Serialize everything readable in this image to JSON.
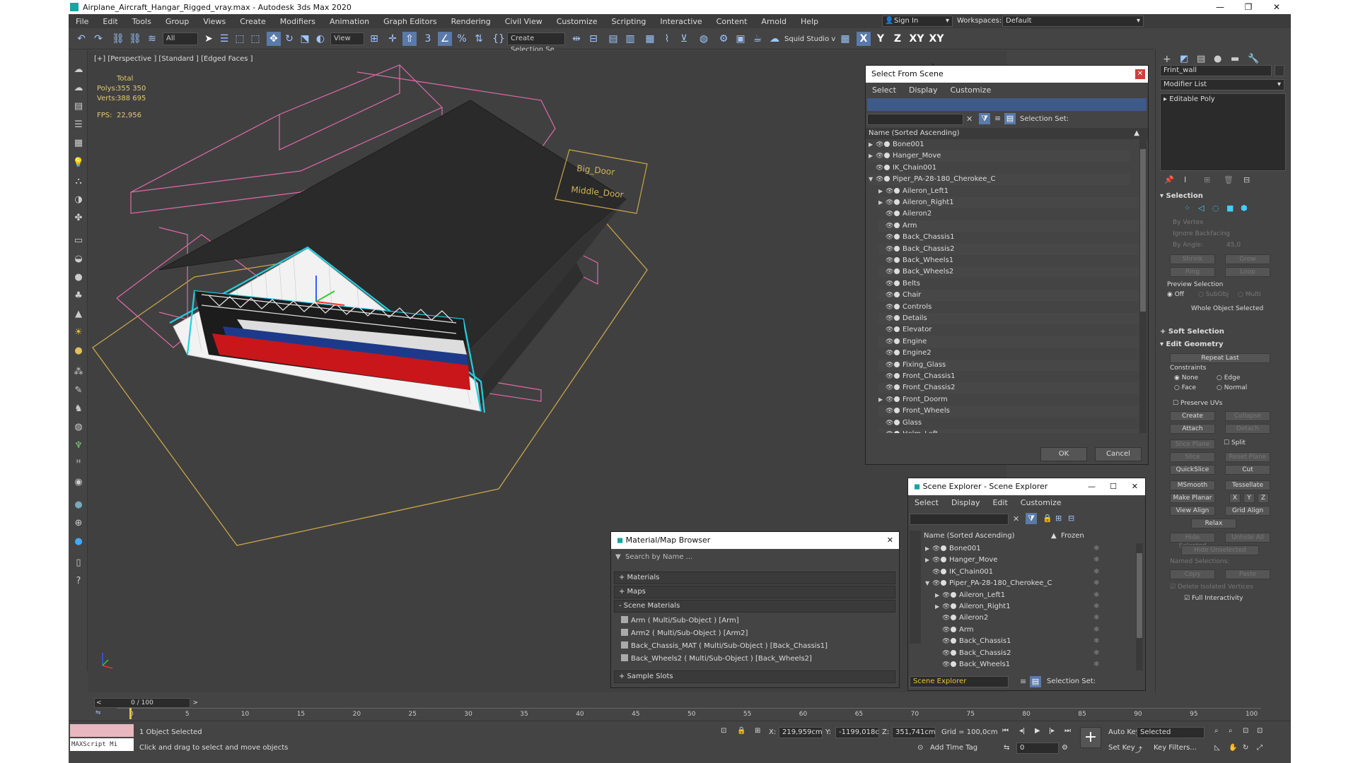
{
  "window": {
    "title": "Airplane_Aircraft_Hangar_Rigged_vray.max - Autodesk 3ds Max 2020"
  },
  "menu": [
    "File",
    "Edit",
    "Tools",
    "Group",
    "Views",
    "Create",
    "Modifiers",
    "Animation",
    "Graph Editors",
    "Rendering",
    "Civil View",
    "Customize",
    "Scripting",
    "Interactive",
    "Content",
    "Arnold",
    "Help"
  ],
  "signin": {
    "label": "Sign In"
  },
  "workspace": {
    "label": "Workspaces:",
    "value": "Default"
  },
  "toolbar": {
    "filter": "All",
    "view": "View",
    "selection_set": "Create Selection Se",
    "squid": "Squid Studio v",
    "axes": [
      "X",
      "Y",
      "Z",
      "XY",
      "XY"
    ]
  },
  "viewport": {
    "label": "[+] [Perspective ] [Standard ] [Edged Faces ]",
    "stats": {
      "total": "Total",
      "polys_label": "Polys:",
      "polys": "355 350",
      "verts_label": "Verts:",
      "verts": "388 695",
      "fps_label": "FPS:",
      "fps": "22,956"
    },
    "helpers": [
      "Big_Door",
      "Middle_Door"
    ]
  },
  "right_panel": {
    "object_name": "Frint_wall",
    "modifier_list": "Modifier List",
    "stack_item": "Editable Poly",
    "selection_title": "Selection",
    "by_vertex": "By Vertex",
    "ignore_backfacing": "Ignore Backfacing",
    "by_angle": "By Angle:",
    "angle": "45,0",
    "shrink": "Shrink",
    "grow": "Grow",
    "ring": "Ring",
    "loop": "Loop",
    "preview_selection": "Preview Selection",
    "preview_opts": [
      "Off",
      "SubObj",
      "Multi"
    ],
    "whole_object": "Whole Object Selected",
    "soft_selection": "Soft Selection",
    "edit_geometry": "Edit Geometry",
    "repeat_last": "Repeat Last",
    "constraints": "Constraints",
    "constraint_opts": [
      "None",
      "Edge",
      "Face",
      "Normal"
    ],
    "preserve_uvs": "Preserve UVs",
    "buttons": [
      "Create",
      "Collapse",
      "Attach",
      "Detach",
      "Slice Plane",
      "Split",
      "Slice",
      "Reset Plane",
      "QuickSlice",
      "Cut",
      "MSmooth",
      "Tessellate",
      "Make Planar",
      "X",
      "Y",
      "Z",
      "View Align",
      "Grid Align",
      "Relax",
      "Hide Selected",
      "Unhide All",
      "Hide Unselected"
    ],
    "named_selections": "Named Selections:",
    "copy": "Copy",
    "paste": "Paste",
    "delete_isolated": "Delete Isolated Vertices",
    "full_interactivity": "Full Interactivity"
  },
  "select_from_scene": {
    "title": "Select From Scene",
    "menu": [
      "Select",
      "Display",
      "Customize"
    ],
    "selection_set": "Selection Set:",
    "column": "Name (Sorted Ascending)",
    "items": [
      {
        "name": "Bone001",
        "level": 0,
        "arrow": "▶"
      },
      {
        "name": "Hanger_Move",
        "level": 0,
        "arrow": "▶"
      },
      {
        "name": "IK_Chain001",
        "level": 0,
        "arrow": ""
      },
      {
        "name": "Piper_PA-28-180_Cherokee_C",
        "level": 0,
        "arrow": "▼"
      },
      {
        "name": "Aileron_Left1",
        "level": 1,
        "arrow": "▶"
      },
      {
        "name": "Aileron_Right1",
        "level": 1,
        "arrow": "▶"
      },
      {
        "name": "Aileron2",
        "level": 1,
        "arrow": ""
      },
      {
        "name": "Arm",
        "level": 1,
        "arrow": ""
      },
      {
        "name": "Back_Chassis1",
        "level": 1,
        "arrow": ""
      },
      {
        "name": "Back_Chassis2",
        "level": 1,
        "arrow": ""
      },
      {
        "name": "Back_Wheels1",
        "level": 1,
        "arrow": ""
      },
      {
        "name": "Back_Wheels2",
        "level": 1,
        "arrow": ""
      },
      {
        "name": "Belts",
        "level": 1,
        "arrow": ""
      },
      {
        "name": "Chair",
        "level": 1,
        "arrow": ""
      },
      {
        "name": "Controls",
        "level": 1,
        "arrow": ""
      },
      {
        "name": "Details",
        "level": 1,
        "arrow": ""
      },
      {
        "name": "Elevator",
        "level": 1,
        "arrow": ""
      },
      {
        "name": "Engine",
        "level": 1,
        "arrow": ""
      },
      {
        "name": "Engine2",
        "level": 1,
        "arrow": ""
      },
      {
        "name": "Fixing_Glass",
        "level": 1,
        "arrow": ""
      },
      {
        "name": "Front_Chassis1",
        "level": 1,
        "arrow": ""
      },
      {
        "name": "Front_Chassis2",
        "level": 1,
        "arrow": ""
      },
      {
        "name": "Front_Doorm",
        "level": 1,
        "arrow": "▶"
      },
      {
        "name": "Front_Wheels",
        "level": 1,
        "arrow": ""
      },
      {
        "name": "Glass",
        "level": 1,
        "arrow": ""
      },
      {
        "name": "Helm_Left",
        "level": 1,
        "arrow": ""
      }
    ],
    "ok": "OK",
    "cancel": "Cancel"
  },
  "scene_explorer": {
    "title": "Scene Explorer - Scene Explorer",
    "menu": [
      "Select",
      "Display",
      "Edit",
      "Customize"
    ],
    "col_name": "Name (Sorted Ascending)",
    "col_frozen": "Frozen",
    "items": [
      {
        "name": "Bone001",
        "level": 0,
        "arrow": "▶"
      },
      {
        "name": "Hanger_Move",
        "level": 0,
        "arrow": "▶"
      },
      {
        "name": "IK_Chain001",
        "level": 0,
        "arrow": ""
      },
      {
        "name": "Piper_PA-28-180_Cherokee_C",
        "level": 0,
        "arrow": "▼"
      },
      {
        "name": "Aileron_Left1",
        "level": 1,
        "arrow": "▶"
      },
      {
        "name": "Aileron_Right1",
        "level": 1,
        "arrow": "▶"
      },
      {
        "name": "Aileron2",
        "level": 1,
        "arrow": ""
      },
      {
        "name": "Arm",
        "level": 1,
        "arrow": ""
      },
      {
        "name": "Back_Chassis1",
        "level": 1,
        "arrow": ""
      },
      {
        "name": "Back_Chassis2",
        "level": 1,
        "arrow": ""
      },
      {
        "name": "Back_Wheels1",
        "level": 1,
        "arrow": ""
      }
    ],
    "footer_name": "Scene Explorer",
    "selection_set": "Selection Set:"
  },
  "material_browser": {
    "title": "Material/Map Browser",
    "search": "Search by Name ...",
    "materials": "+ Materials",
    "maps": "+ Maps",
    "scene_materials": "- Scene Materials",
    "items": [
      "Arm  ( Multi/Sub-Object )  [Arm]",
      "Arm2  ( Multi/Sub-Object )  [Arm2]",
      "Back_Chassis_MAT  ( Multi/Sub-Object )  [Back_Chassis1]",
      "Back_Wheels2  ( Multi/Sub-Object )  [Back_Wheels2]"
    ],
    "sample_slots": "+ Sample Slots"
  },
  "timeline": {
    "frame": "0 / 100",
    "ticks": [
      "0",
      "5",
      "10",
      "15",
      "20",
      "25",
      "30",
      "35",
      "40",
      "45",
      "50",
      "55",
      "60",
      "65",
      "70",
      "75",
      "80",
      "85",
      "90",
      "95",
      "100"
    ]
  },
  "status": {
    "maxscript": "MAXScript Mi",
    "selected": "1 Object Selected",
    "hint": "Click and drag to select and move objects",
    "x_label": "X:",
    "x": "219,959cm",
    "y_label": "Y:",
    "y": "-1199,018c",
    "z_label": "Z:",
    "z": "351,741cm",
    "grid": "Grid = 100,0cm",
    "add_time_tag": "Add Time Tag",
    "auto_key": "Auto Key",
    "selected_dd": "Selected",
    "set_key": "Set Key",
    "key_filters": "Key Filters...",
    "frame_field": "0"
  }
}
